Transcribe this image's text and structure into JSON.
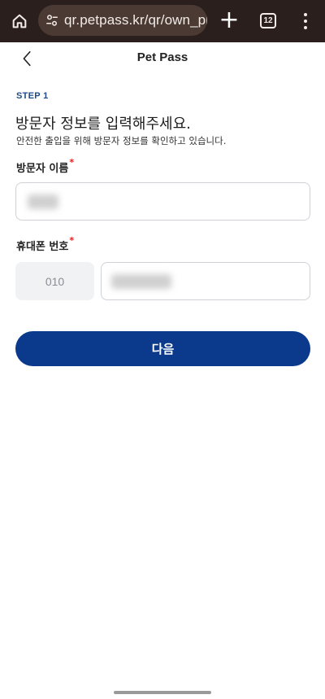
{
  "browser": {
    "url": "qr.petpass.kr/qr/own_pho",
    "tab_count": "12",
    "new_tab_symbol": "+"
  },
  "header": {
    "title": "Pet Pass"
  },
  "step": {
    "label": "STEP 1",
    "headline": "방문자 정보를 입력해주세요.",
    "subline": "안전한 출입을 위해 방문자 정보를 확인하고 있습니다."
  },
  "form": {
    "name_label": "방문자 이름",
    "phone_label": "휴대폰 번호",
    "required_mark": "*",
    "phone_prefix": "010"
  },
  "actions": {
    "next_label": "다음"
  },
  "colors": {
    "browser_bar": "#2a1f1c",
    "accent": "#0b3a8c",
    "step_label": "#1f4a87",
    "required": "#e02020"
  },
  "icons": [
    "home-icon",
    "tune-icon",
    "back-arrow-icon",
    "more-vert-icon"
  ]
}
